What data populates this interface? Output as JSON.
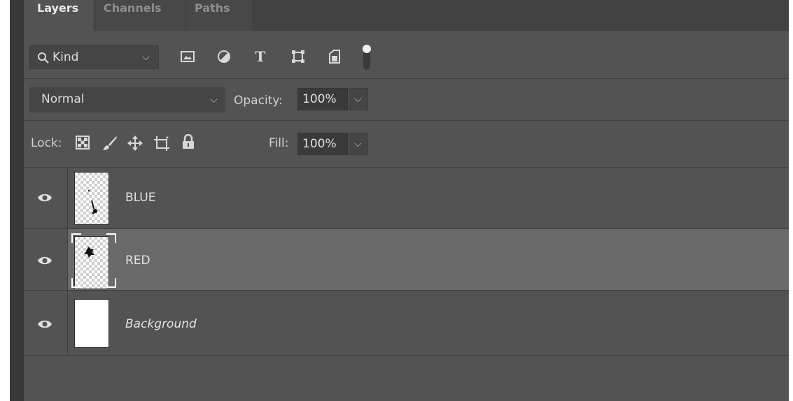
{
  "tabs": [
    {
      "label": "Layers",
      "active": true
    },
    {
      "label": "Channels",
      "active": false
    },
    {
      "label": "Paths",
      "active": false
    }
  ],
  "filter": {
    "kind_label": "Kind",
    "icons": [
      "image-filter-icon",
      "adjustment-filter-icon",
      "type-filter-icon",
      "shape-filter-icon",
      "smart-object-filter-icon",
      "filter-toggle-icon"
    ]
  },
  "blending": {
    "mode": "Normal",
    "opacity_label": "Opacity:",
    "opacity_value": "100%"
  },
  "lock": {
    "label": "Lock:",
    "icons": [
      "lock-transparent-pixels-icon",
      "lock-image-pixels-icon",
      "lock-position-icon",
      "lock-artboard-icon",
      "lock-all-icon"
    ],
    "fill_label": "Fill:",
    "fill_value": "100%"
  },
  "layers": [
    {
      "name": "BLUE",
      "visible": true,
      "selected": false,
      "italic": false
    },
    {
      "name": "RED",
      "visible": true,
      "selected": true,
      "italic": false
    },
    {
      "name": "Background",
      "visible": true,
      "selected": false,
      "italic": true
    }
  ],
  "colors": {
    "panel_bg": "#535353",
    "selected_row": "#6a6a6a",
    "tab_bar": "#424242"
  }
}
